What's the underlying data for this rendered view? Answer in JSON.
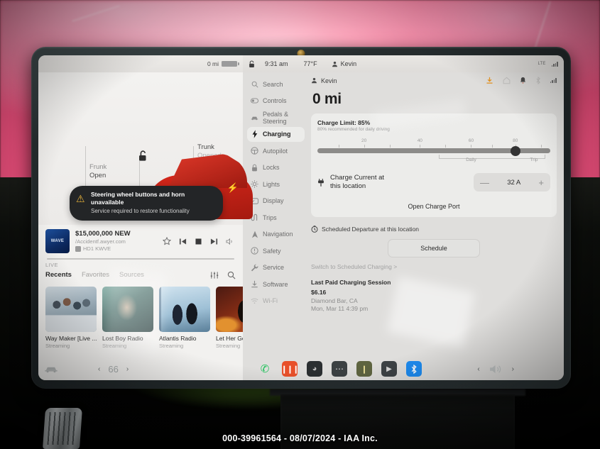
{
  "statusbar": {
    "range": "0 mi",
    "lock_icon": "unlock-icon",
    "time": "9:31 am",
    "temperature": "77°F",
    "driver": "Kevin",
    "network_label": "LTE"
  },
  "car_panel": {
    "frunk": {
      "label": "Frunk",
      "state": "Open"
    },
    "trunk": {
      "label": "Trunk",
      "state": "Opened"
    },
    "alert": {
      "title": "Steering wheel buttons and horn unavailable",
      "subtitle": "Service required to restore functionality",
      "icon": "warning-triangle-icon"
    }
  },
  "media": {
    "station_title": "$15,000,000 NEW",
    "station_url": "/Accidentf.awyer.com",
    "station_call": "HD1 KWVE",
    "album_art_text": "WAVE",
    "live_label": "LIVE",
    "controls": [
      "favorite-star-icon",
      "previous-track-icon",
      "stop-icon",
      "next-track-icon",
      "volume-icon"
    ],
    "tabs": [
      {
        "label": "Recents",
        "active": true
      },
      {
        "label": "Favorites",
        "active": false
      },
      {
        "label": "Sources",
        "active": false
      }
    ],
    "tools": [
      "equalizer-icon",
      "search-icon"
    ],
    "tiles": [
      {
        "name": "Way Maker [Live ...",
        "sub": "Streaming"
      },
      {
        "name": "Lost Boy Radio",
        "sub": "Streaming"
      },
      {
        "name": "Atlantis Radio",
        "sub": "Streaming"
      },
      {
        "name": "Let Her Go",
        "sub": "Streaming"
      }
    ]
  },
  "settings": {
    "nav": [
      {
        "label": "Search",
        "icon": "search-icon",
        "active": false
      },
      {
        "label": "Controls",
        "icon": "toggle-icon",
        "active": false
      },
      {
        "label": "Pedals & Steering",
        "icon": "car-icon",
        "active": false
      },
      {
        "label": "Charging",
        "icon": "bolt-icon",
        "active": true
      },
      {
        "label": "Autopilot",
        "icon": "steering-wheel-icon",
        "active": false
      },
      {
        "label": "Locks",
        "icon": "lock-icon",
        "active": false
      },
      {
        "label": "Lights",
        "icon": "light-icon",
        "active": false
      },
      {
        "label": "Display",
        "icon": "display-icon",
        "active": false
      },
      {
        "label": "Trips",
        "icon": "trips-icon",
        "active": false
      },
      {
        "label": "Navigation",
        "icon": "navigation-arrow-icon",
        "active": false
      },
      {
        "label": "Safety",
        "icon": "safety-alert-icon",
        "active": false
      },
      {
        "label": "Service",
        "icon": "wrench-icon",
        "active": false
      },
      {
        "label": "Software",
        "icon": "download-icon",
        "active": false
      },
      {
        "label": "Wi-Fi",
        "icon": "wifi-icon",
        "active": false
      }
    ],
    "header": {
      "profile": "Kevin",
      "icons": [
        "charging-download-icon",
        "home-icon",
        "notification-bell-icon",
        "bluetooth-icon",
        "signal-icon"
      ]
    },
    "range_big": "0 mi",
    "charge_limit": {
      "title": "Charge Limit: 85%",
      "subtitle": "80% recommended for daily driving",
      "value": 85,
      "ticks": [
        20,
        40,
        60,
        80
      ],
      "daily_label": "Daily",
      "trip_label": "Trip"
    },
    "charge_current": {
      "label_line1": "Charge Current at",
      "label_line2": "this location",
      "icon": "charge-plug-icon",
      "minus": "—",
      "value": "32 A",
      "plus": "+"
    },
    "open_charge_port": "Open Charge Port",
    "scheduled_departure": {
      "label": "Scheduled Departure at this location",
      "icon": "clock-icon",
      "button": "Schedule",
      "switch_link": "Switch to Scheduled Charging >"
    },
    "last_paid": {
      "title": "Last Paid Charging Session",
      "amount": "$6.16",
      "location": "Diamond Bar, CA",
      "datetime": "Mon, Mar 11 4:39 pm"
    }
  },
  "dock": {
    "car_icon": "car-icon",
    "temperature": "66",
    "prev": "‹",
    "next": "›",
    "apps": [
      {
        "name": "phone-app-icon",
        "glyph": "✆",
        "color": "#1db954",
        "bg": "transparent"
      },
      {
        "name": "media-app-icon",
        "glyph": "‖",
        "color": "#ffffff",
        "bg": "#e8502a"
      },
      {
        "name": "energy-app-icon",
        "glyph": "◔",
        "color": "#cfcfcf",
        "bg": "#2a2e30"
      },
      {
        "name": "more-apps-icon",
        "glyph": "…",
        "color": "#dddddd",
        "bg": "#3a3f41"
      },
      {
        "name": "browser-app-icon",
        "glyph": "❘",
        "color": "#e2d27a",
        "bg": "#5a5f3a"
      },
      {
        "name": "theater-app-icon",
        "glyph": "▶",
        "color": "#d5d5d5",
        "bg": "#3d4245"
      },
      {
        "name": "bluetooth-app-icon",
        "glyph": "Ƀ",
        "color": "#ffffff",
        "bg": "#1d8bf0"
      }
    ],
    "volume_icon": "volume-icon"
  },
  "watermark": "000-39961564 - 08/07/2024 - IAA Inc."
}
